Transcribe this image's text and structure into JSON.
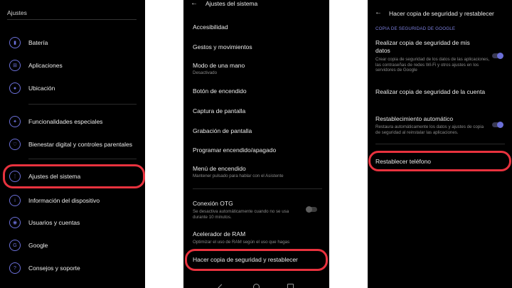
{
  "panel1": {
    "header": "Ajustes",
    "items": [
      {
        "label": "Batería",
        "icon": "battery-icon"
      },
      {
        "label": "Aplicaciones",
        "icon": "apps-grid-icon"
      },
      {
        "label": "Ubicación",
        "icon": "location-pin-icon"
      },
      {
        "label": "Funcionalidades especiales",
        "icon": "special-features-icon"
      },
      {
        "label": "Bienestar digital y controles parentales",
        "icon": "digital-wellbeing-icon"
      },
      {
        "label": "Ajustes del sistema",
        "icon": "system-settings-icon"
      },
      {
        "label": "Información del dispositivo",
        "icon": "info-icon"
      },
      {
        "label": "Usuarios y cuentas",
        "icon": "users-icon"
      },
      {
        "label": "Google",
        "icon": "google-icon"
      },
      {
        "label": "Consejos y soporte",
        "icon": "help-icon"
      }
    ]
  },
  "panel2": {
    "title": "Ajustes del sistema",
    "items": [
      {
        "label": "Accesibilidad"
      },
      {
        "label": "Gestos y movimientos"
      },
      {
        "label": "Modo de una mano",
        "sub": "Desactivado"
      },
      {
        "label": "Botón de encendido"
      },
      {
        "label": "Captura de pantalla"
      },
      {
        "label": "Grabación de pantalla"
      },
      {
        "label": "Programar encendido/apagado"
      },
      {
        "label": "Menú de encendido",
        "sub": "Mantener pulsado para hablar con el Asistente"
      },
      {
        "label": "Conexión OTG",
        "sub": "Se desactiva automáticamente cuando no se usa durante 10 minutos."
      },
      {
        "label": "Acelerador de RAM",
        "sub": "Optimizar el uso de RAM según el uso que hagas"
      },
      {
        "label": "Hacer copia de seguridad y restablecer"
      }
    ],
    "otg_toggle": "off"
  },
  "panel3": {
    "title": "Hacer copia de seguridad y restablecer",
    "section": "COPIA DE SEGURIDAD DE GOOGLE",
    "items": [
      {
        "label": "Realizar copia de seguridad de mis datos",
        "sub": "Crear copia de seguridad de los datos de las aplicaciones, las contraseñas de redes Wi-Fi y otros ajustes en los servidores de Google",
        "toggle": "on"
      },
      {
        "label": "Realizar copia de seguridad de la cuenta"
      },
      {
        "label": "Restablecimiento automático",
        "sub": "Restaura automáticamente los datos y ajustes de copia de seguridad al reinstalar las aplicaciones.",
        "toggle": "on"
      },
      {
        "label": "Restablecer teléfono"
      }
    ]
  },
  "colors": {
    "accent": "#6b6fd8",
    "highlight": "#e8323e",
    "background": "#000000"
  }
}
